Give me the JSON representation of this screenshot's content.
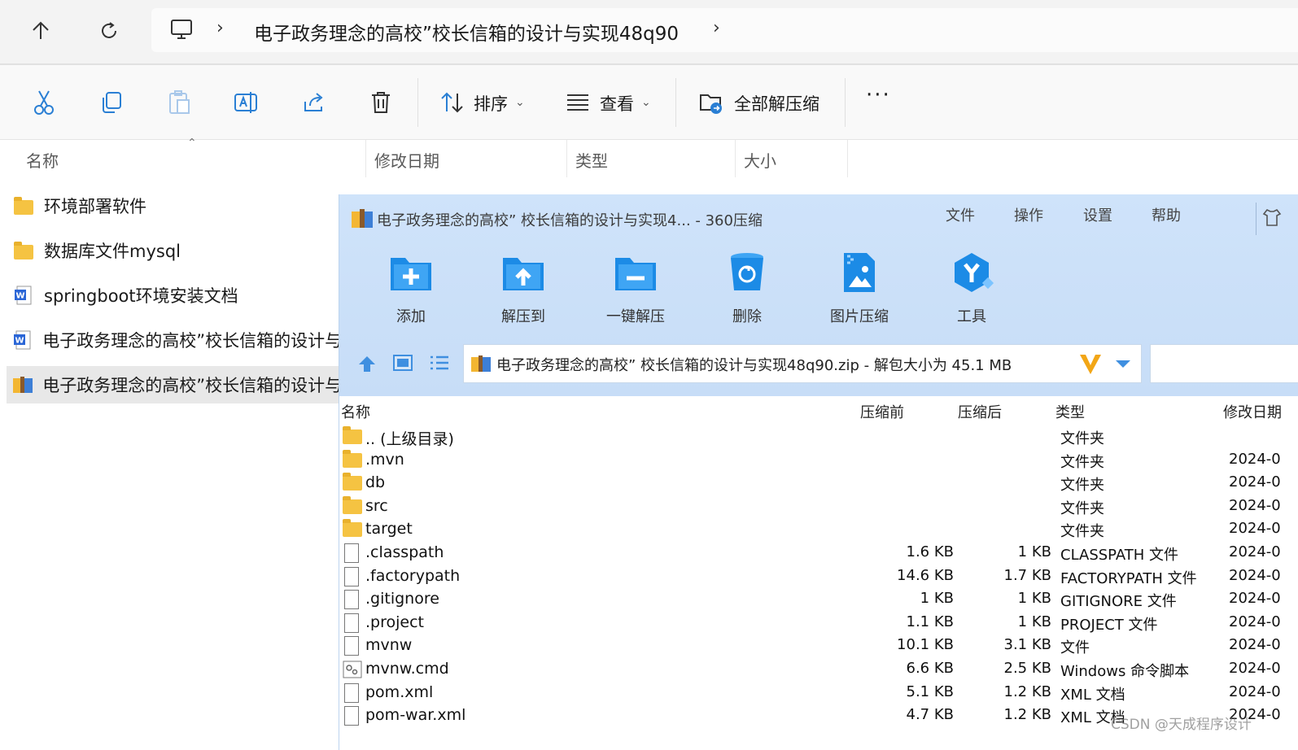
{
  "explorer": {
    "address_path": "电子政务理念的高校”校长信箱的设计与实现48q90",
    "toolbar": {
      "sort_label": "排序",
      "view_label": "查看",
      "extract_all_label": "全部解压缩"
    },
    "columns": [
      "名称",
      "修改日期",
      "类型",
      "大小"
    ],
    "items": [
      {
        "name": "环境部署软件",
        "icon": "folder-icon"
      },
      {
        "name": "数据库文件mysql",
        "icon": "folder-icon"
      },
      {
        "name": "springboot环境安装文档",
        "icon": "word-doc-icon"
      },
      {
        "name": "电子政务理念的高校”校长信箱的设计与...",
        "icon": "word-doc-icon"
      },
      {
        "name": "电子政务理念的高校”校长信箱的设计与...",
        "icon": "zip-archive-icon",
        "selected": true
      }
    ]
  },
  "zip_window": {
    "title": "电子政务理念的高校” 校长信箱的设计与实现4... - 360压缩",
    "menu": [
      "文件",
      "操作",
      "设置",
      "帮助"
    ],
    "actions": [
      "添加",
      "解压到",
      "一键解压",
      "删除",
      "图片压缩",
      "工具"
    ],
    "path_text": "电子政务理念的高校” 校长信箱的设计与实现48q90.zip - 解包大小为 45.1 MB",
    "columns": {
      "name": "名称",
      "before": "压缩前",
      "after": "压缩后",
      "type": "类型",
      "date": "修改日期"
    },
    "rows": [
      {
        "name": ".. (上级目录)",
        "before": "",
        "after": "",
        "type": "文件夹",
        "date": "",
        "icon": "folder"
      },
      {
        "name": ".mvn",
        "before": "",
        "after": "",
        "type": "文件夹",
        "date": "2024-0",
        "icon": "folder"
      },
      {
        "name": "db",
        "before": "",
        "after": "",
        "type": "文件夹",
        "date": "2024-0",
        "icon": "folder"
      },
      {
        "name": "src",
        "before": "",
        "after": "",
        "type": "文件夹",
        "date": "2024-0",
        "icon": "folder"
      },
      {
        "name": "target",
        "before": "",
        "after": "",
        "type": "文件夹",
        "date": "2024-0",
        "icon": "folder"
      },
      {
        "name": ".classpath",
        "before": "1.6 KB",
        "after": "1 KB",
        "type": "CLASSPATH 文件",
        "date": "2024-0",
        "icon": "file"
      },
      {
        "name": ".factorypath",
        "before": "14.6 KB",
        "after": "1.7 KB",
        "type": "FACTORYPATH 文件",
        "date": "2024-0",
        "icon": "file"
      },
      {
        "name": ".gitignore",
        "before": "1 KB",
        "after": "1 KB",
        "type": "GITIGNORE 文件",
        "date": "2024-0",
        "icon": "file"
      },
      {
        "name": ".project",
        "before": "1.1 KB",
        "after": "1 KB",
        "type": "PROJECT 文件",
        "date": "2024-0",
        "icon": "file"
      },
      {
        "name": "mvnw",
        "before": "10.1 KB",
        "after": "3.1 KB",
        "type": "文件",
        "date": "2024-0",
        "icon": "file"
      },
      {
        "name": "mvnw.cmd",
        "before": "6.6 KB",
        "after": "2.5 KB",
        "type": "Windows 命令脚本",
        "date": "2024-0",
        "icon": "cmd"
      },
      {
        "name": "pom.xml",
        "before": "5.1 KB",
        "after": "1.2 KB",
        "type": "XML 文档",
        "date": "2024-0",
        "icon": "file"
      },
      {
        "name": "pom-war.xml",
        "before": "4.7 KB",
        "after": "1.2 KB",
        "type": "XML 文档",
        "date": "2024-0",
        "icon": "file"
      }
    ]
  },
  "watermark": "CSDN @天成程序设计"
}
